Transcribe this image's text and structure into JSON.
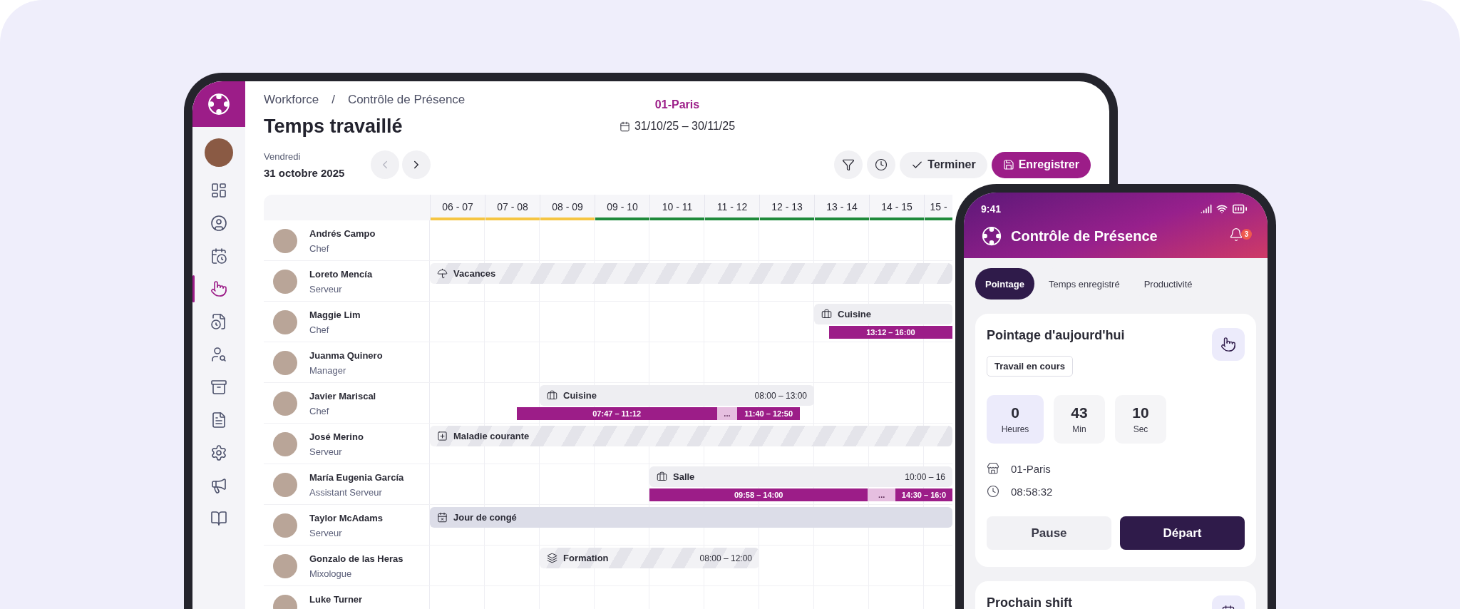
{
  "sidebar": {
    "items": [
      {
        "selected": false
      },
      {
        "selected": false
      },
      {
        "selected": false
      },
      {
        "selected": true
      },
      {
        "selected": false
      },
      {
        "selected": false
      },
      {
        "selected": false
      },
      {
        "selected": false
      },
      {
        "selected": false
      },
      {
        "selected": false
      },
      {
        "selected": false
      }
    ]
  },
  "breadcrumb": [
    "Workforce",
    "Contrôle de Présence"
  ],
  "breadcrumb_separator": "/",
  "title": "Temps travaillé",
  "location": "01-Paris",
  "date_range": "31/10/25 – 30/11/25",
  "day": {
    "weekday": "Vendredi",
    "date": "31 octobre 2025"
  },
  "actions": {
    "finish": "Terminer",
    "save": "Enregistrer"
  },
  "schedule": {
    "hours": [
      {
        "label": "06 - 07",
        "color": "#f5c542"
      },
      {
        "label": "07 - 08",
        "color": "#f5c542"
      },
      {
        "label": "08 - 09",
        "color": "#f5c542"
      },
      {
        "label": "09 - 10",
        "color": "#1f8a3b"
      },
      {
        "label": "10 - 11",
        "color": "#1f8a3b"
      },
      {
        "label": "11 - 12",
        "color": "#1f8a3b"
      },
      {
        "label": "12 - 13",
        "color": "#1f8a3b"
      },
      {
        "label": "13 - 14",
        "color": "#1f8a3b"
      },
      {
        "label": "14 - 15",
        "color": "#1f8a3b"
      },
      {
        "label": "15 -",
        "color": "#1f8a3b"
      }
    ],
    "rows": [
      {
        "name": "Andrés Campo",
        "role": "Chef"
      },
      {
        "name": "Loreto Mencía",
        "role": "Serveur",
        "planned": {
          "kind": "vacation",
          "label": "Vacances"
        }
      },
      {
        "name": "Maggie Lim",
        "role": "Chef",
        "planned": {
          "kind": "shift",
          "label": "Cuisine"
        },
        "punches": [
          {
            "kind": "work",
            "label": "13:12 – 16:00"
          }
        ]
      },
      {
        "name": "Juanma Quinero",
        "role": "Manager"
      },
      {
        "name": "Javier Mariscal",
        "role": "Chef",
        "planned": {
          "kind": "shift",
          "label": "Cuisine",
          "time": "08:00 – 13:00"
        },
        "punches": [
          {
            "kind": "work",
            "label": "07:47 – 11:12"
          },
          {
            "kind": "break",
            "label": "..."
          },
          {
            "kind": "work",
            "label": "11:40 – 12:50"
          }
        ]
      },
      {
        "name": "José Merino",
        "role": "Serveur",
        "planned": {
          "kind": "sick",
          "label": "Maladie courante"
        }
      },
      {
        "name": "María Eugenia García",
        "role": "Assistant Serveur",
        "planned": {
          "kind": "shift",
          "label": "Salle",
          "time": "10:00 – 16"
        },
        "punches": [
          {
            "kind": "work",
            "label": "09:58 – 14:00"
          },
          {
            "kind": "break",
            "label": "..."
          },
          {
            "kind": "work",
            "label": "14:30 – 16:0"
          }
        ]
      },
      {
        "name": "Taylor McAdams",
        "role": "Serveur",
        "planned": {
          "kind": "dayoff",
          "label": "Jour de congé"
        }
      },
      {
        "name": "Gonzalo de las Heras",
        "role": "Mixologue",
        "planned": {
          "kind": "training",
          "label": "Formation",
          "time": "08:00 – 12:00"
        }
      },
      {
        "name": "Luke Turner"
      }
    ]
  },
  "phone": {
    "time": "9:41",
    "title": "Contrôle de Présence",
    "notifications": "3",
    "tabs": [
      {
        "label": "Pointage",
        "selected": true
      },
      {
        "label": "Temps enregistré",
        "selected": false
      },
      {
        "label": "Productivité",
        "selected": false
      }
    ],
    "today": {
      "title": "Pointage d'aujourd'hui",
      "status": "Travail en cours",
      "counters": [
        {
          "value": "0",
          "unit": "Heures",
          "selected": true
        },
        {
          "value": "43",
          "unit": "Min",
          "selected": false
        },
        {
          "value": "10",
          "unit": "Sec",
          "selected": false
        }
      ],
      "site": "01-Paris",
      "clock_in": "08:58:32",
      "buttons": [
        {
          "kind": "secondary",
          "label": "Pause"
        },
        {
          "kind": "primary",
          "label": "Départ"
        }
      ]
    },
    "next": {
      "title": "Prochain shift"
    }
  }
}
